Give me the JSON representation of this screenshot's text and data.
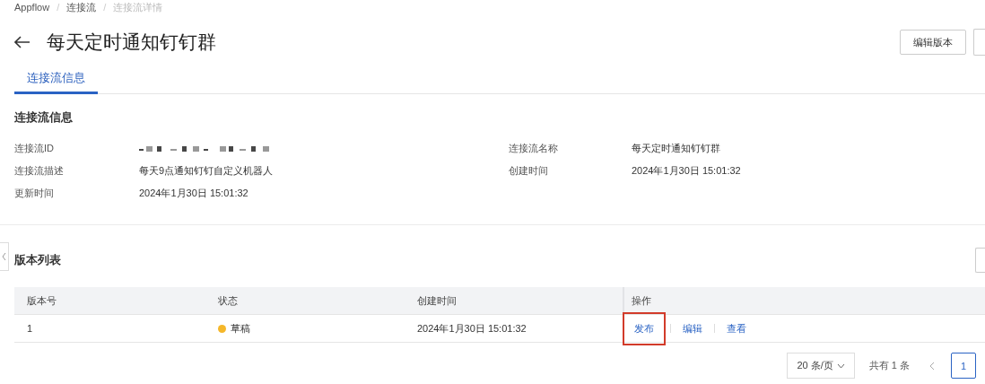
{
  "breadcrumb_separator": "/",
  "breadcrumb": [
    {
      "label": "Appflow",
      "current": false
    },
    {
      "label": "连接流",
      "current": false
    },
    {
      "label": "连接流详情",
      "current": true
    }
  ],
  "title": "每天定时通知钉钉群",
  "header_buttons": [
    "编辑版本"
  ],
  "tabs": [
    {
      "label": "连接流信息",
      "selected": true
    }
  ],
  "info_section": {
    "title": "连接流信息",
    "fields": [
      {
        "label": "连接流ID",
        "kind": "redacted"
      },
      {
        "label": "连接流名称",
        "kind": "text",
        "value": "每天定时通知钉钉群"
      },
      {
        "label": "连接流描述",
        "kind": "text",
        "value": "每天9点通知钉钉自定义机器人"
      },
      {
        "label": "创建时间",
        "kind": "text",
        "value": "2024年1月30日 15:01:32"
      },
      {
        "label": "更新时间",
        "kind": "text",
        "value": "2024年1月30日 15:01:32"
      }
    ]
  },
  "versions": {
    "title": "版本列表",
    "columns": [
      "版本号",
      "状态",
      "创建时间",
      "操作"
    ],
    "rows": [
      {
        "version": "1",
        "status": {
          "label": "草稿",
          "color": "#f5b72a"
        },
        "created": "2024年1月30日 15:01:32",
        "actions": [
          {
            "label": "发布",
            "highlighted": true
          },
          {
            "label": "编辑",
            "highlighted": false
          },
          {
            "label": "查看",
            "highlighted": false
          }
        ]
      }
    ]
  },
  "pagination": {
    "page_size": "20 条/页",
    "total": "共有 1 条",
    "pages": [
      {
        "label": "1",
        "selected": true
      }
    ]
  }
}
